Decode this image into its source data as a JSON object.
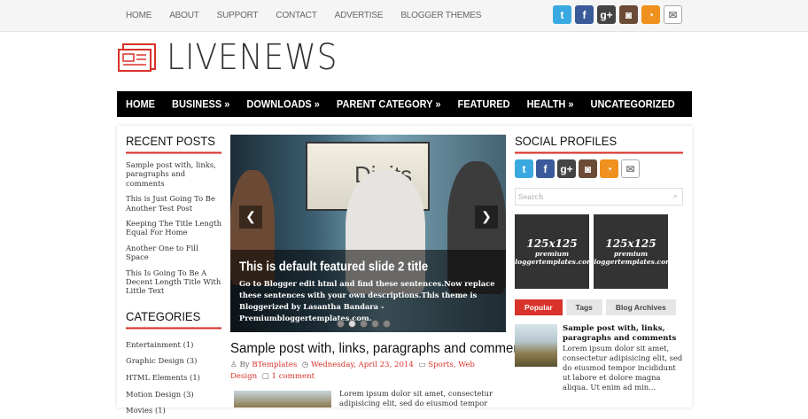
{
  "topnav": [
    "HOME",
    "ABOUT",
    "SUPPORT",
    "CONTACT",
    "ADVERTISE",
    "BLOGGER THEMES"
  ],
  "social_icons": [
    "twitter-icon",
    "facebook-icon",
    "google-plus-icon",
    "instagram-icon",
    "rss-icon",
    "mail-icon"
  ],
  "logo": {
    "text": "LIVENEWS",
    "accent": "#d8322a"
  },
  "mainnav": [
    "HOME",
    "BUSINESS »",
    "DOWNLOADS »",
    "PARENT CATEGORY »",
    "FEATURED",
    "HEALTH »",
    "UNCATEGORIZED"
  ],
  "recent_posts": {
    "title": "RECENT POSTS",
    "items": [
      "Sample post with, links, paragraphs and comments",
      "This is Just Going To Be Another Test Post",
      "Keeping The Title Length Equal For Home",
      "Another One to Fill Space",
      "This Is Going To Be A Decent Length Title With Little Text"
    ]
  },
  "categories": {
    "title": "CATEGORIES",
    "items": [
      "Entertainment (1)",
      "Graphic Design (3)",
      "HTML Elements (1)",
      "Motion Design (3)",
      "Movies (1)"
    ]
  },
  "slider": {
    "screen_text": "Digits",
    "title": "This is default featured slide 2 title",
    "text": "Go to Blogger edit html and find these sentences.Now replace these sentences with your own descriptions.This theme is Bloggerized by Lasantha Bandara - Premiumbloggertemplates.com.",
    "active_dot": 2
  },
  "post": {
    "title": "Sample post with, links, paragraphs and comments",
    "by": "By",
    "author": "BTemplates",
    "date": "Wednesday, April 23, 2014",
    "categories": "Sports, Web Design",
    "comments": "1 comment",
    "excerpt": "Lorem ipsum dolor sit amet, consectetur adipisicing elit, sed do eiusmod tempor"
  },
  "sidebar": {
    "social_title": "SOCIAL PROFILES",
    "search_placeholder": "Search",
    "ad1_size": "125x125",
    "ad1_line1": "premium",
    "ad1_line2": "bloggertemplates.com",
    "ad2_size": "125x125",
    "ad2_line1": "premium",
    "ad2_line2": "bloggertemplates.com",
    "tabs": [
      "Popular",
      "Tags",
      "Blog Archives"
    ],
    "popular_title": "Sample post with, links, paragraphs and comments",
    "popular_text": "Lorem ipsum dolor sit amet, consectetur adipisicing elit, sed do eiusmod tempor incididunt ut labore et dolore magna aliqua. Ut enim ad min..."
  }
}
